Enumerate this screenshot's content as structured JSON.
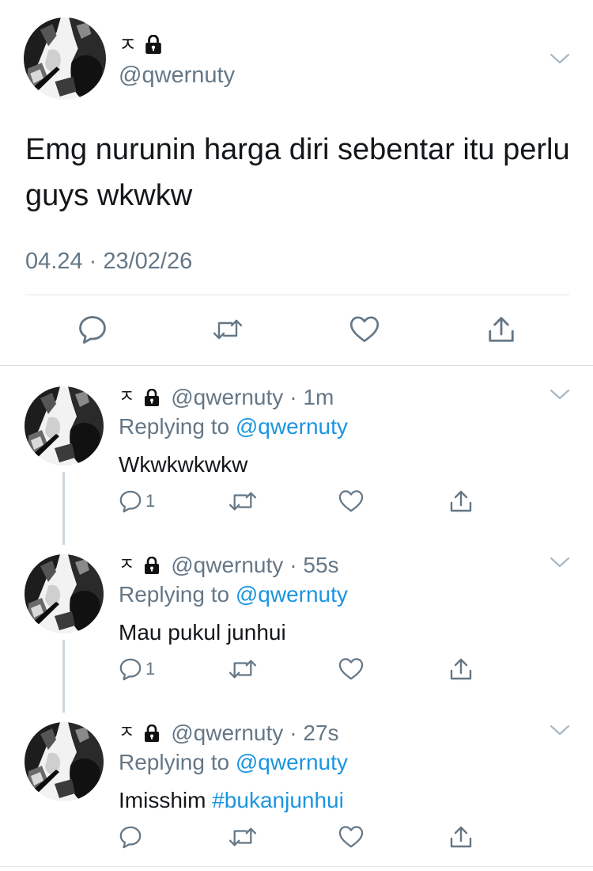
{
  "colors": {
    "text": "#14171a",
    "secondary": "#657786",
    "link": "#1b95e0",
    "divider": "#e1e8ed",
    "thread_line": "#ccd6dd"
  },
  "main_tweet": {
    "display_name": "ㅈ",
    "handle": "@qwernuty",
    "text": "Emg nurunin harga diri sebentar itu perlu guys wkwkw",
    "timestamp": "04.24 · 23/02/26",
    "actions": [
      "reply-icon",
      "retweet-icon",
      "like-icon",
      "share-icon"
    ]
  },
  "replies": [
    {
      "display_name": "ㅈ",
      "handle": "@qwernuty",
      "time": "· 1m",
      "replying_label": "Replying to",
      "replying_to": "@qwernuty",
      "text": "Wkwkwkwkw",
      "hashtag": "",
      "reply_count": "1"
    },
    {
      "display_name": "ㅈ",
      "handle": "@qwernuty",
      "time": "· 55s",
      "replying_label": "Replying to",
      "replying_to": "@qwernuty",
      "text": "Mau pukul junhui",
      "hashtag": "",
      "reply_count": "1"
    },
    {
      "display_name": "ㅈ",
      "handle": "@qwernuty",
      "time": "· 27s",
      "replying_label": "Replying to",
      "replying_to": "@qwernuty",
      "text": "Imisshim ",
      "hashtag": "#bukanjunhui",
      "reply_count": ""
    }
  ]
}
